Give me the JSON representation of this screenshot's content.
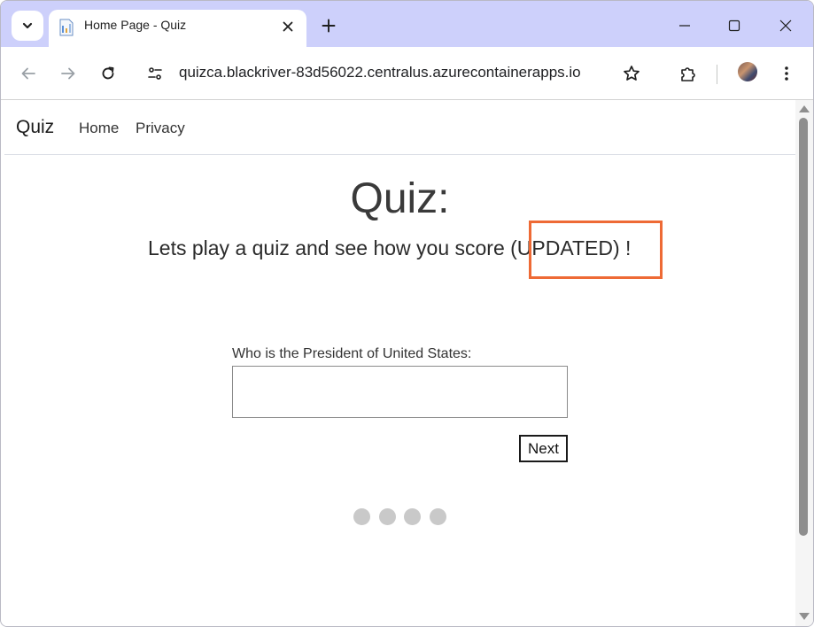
{
  "browser": {
    "tab": {
      "title": "Home Page - Quiz",
      "favicon": "page-favicon-icon"
    },
    "tab_search_icon": "chevron-down-icon",
    "new_tab_icon": "plus-icon",
    "window_controls": [
      "minimize-icon",
      "maximize-icon",
      "close-icon"
    ],
    "toolbar": {
      "back_icon": "arrow-left-icon",
      "forward_icon": "arrow-right-icon",
      "reload_icon": "reload-icon",
      "site_info_icon": "tune-icon",
      "url": "quizca.blackriver-83d56022.centralus.azurecontainerapps.io",
      "bookmark_icon": "star-icon",
      "extensions_icon": "puzzle-icon",
      "menu_icon": "kebab-menu-icon"
    }
  },
  "navbar": {
    "brand": "Quiz",
    "links": [
      "Home",
      "Privacy"
    ]
  },
  "main": {
    "title": "Quiz:",
    "subtitle": "Lets play a quiz and see how you score (UPDATED) !",
    "highlight_color": "#ee6a35",
    "question": "Who is the President of United States:",
    "answer_value": "",
    "next_label": "Next",
    "progress_dots": 4
  },
  "colors": {
    "tabstrip": "#cdd0fb",
    "dot": "#c9c9c9"
  }
}
